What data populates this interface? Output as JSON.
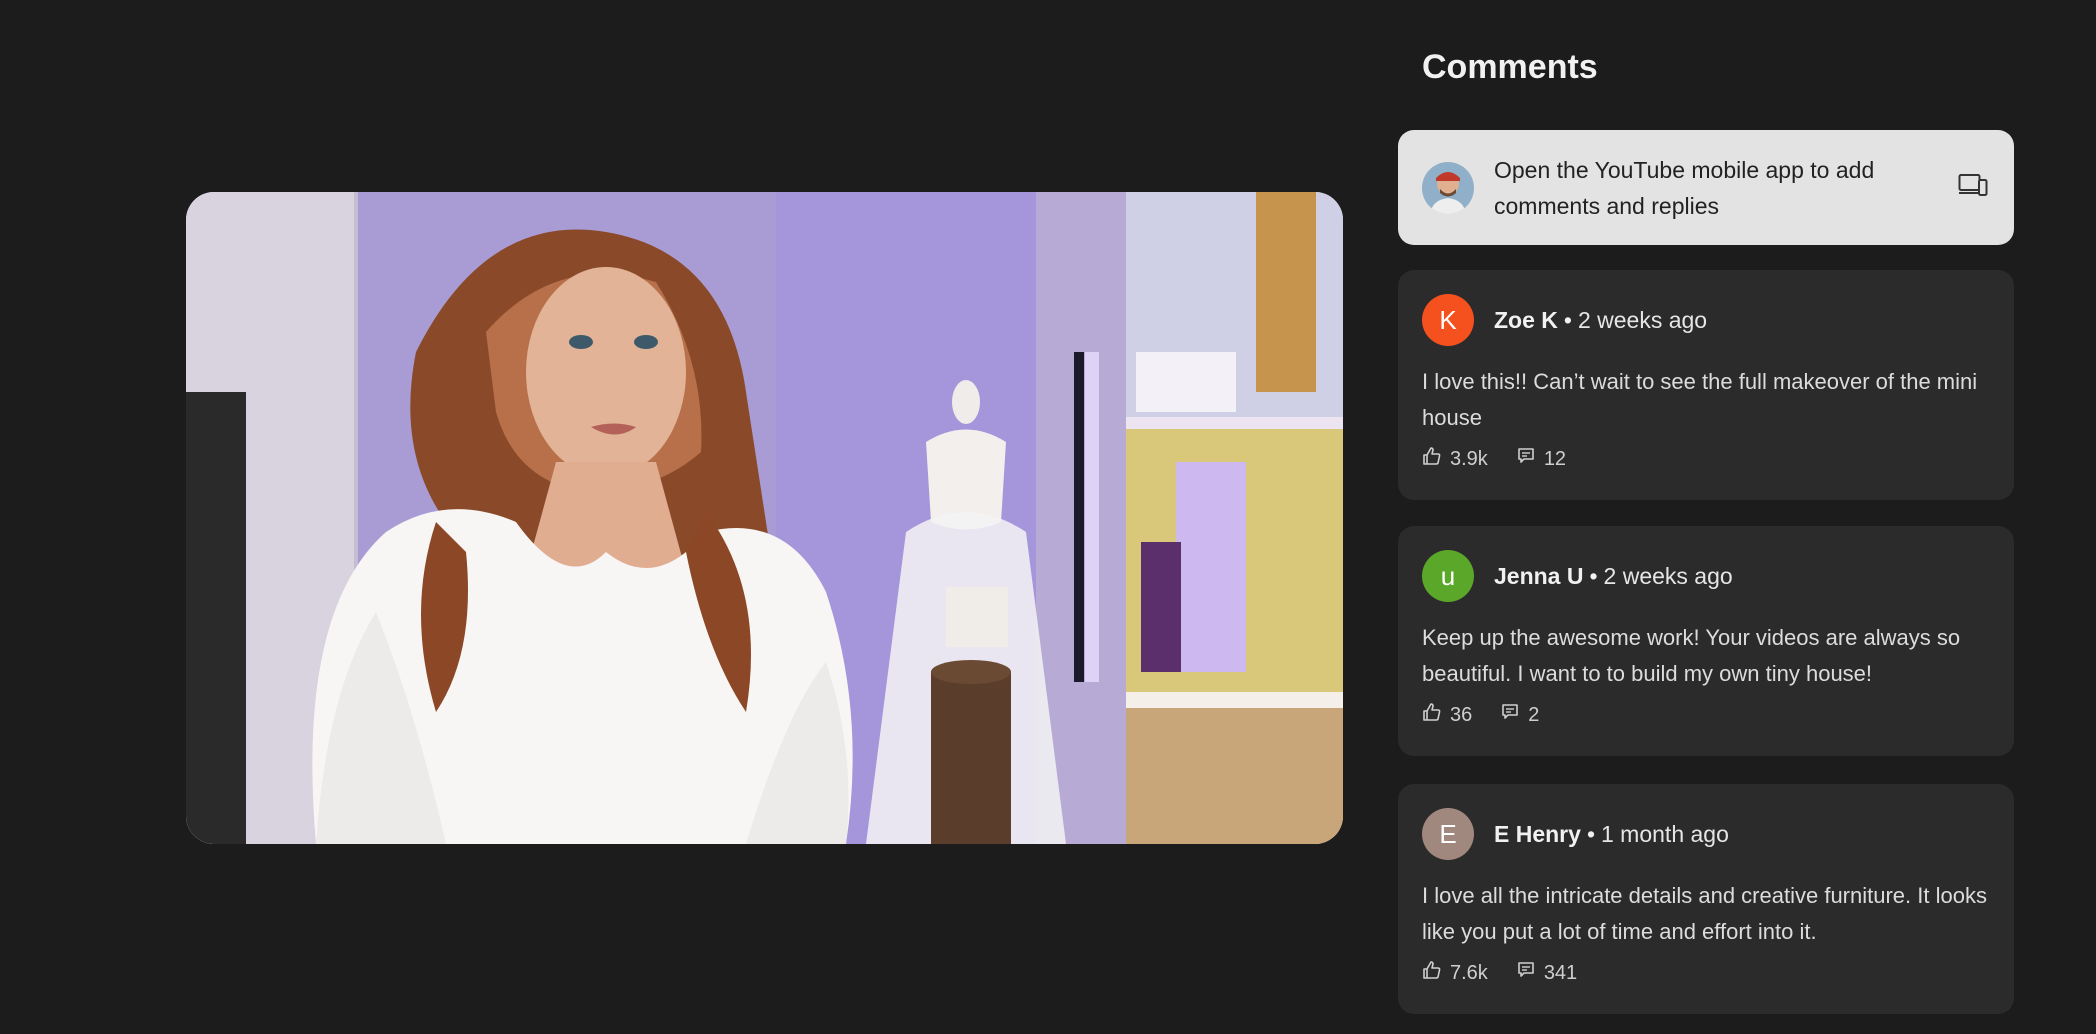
{
  "panel": {
    "title": "Comments",
    "notice": "Open the YouTube mobile app to add comments and replies"
  },
  "comments": [
    {
      "initial": "K",
      "avatar_color": "#f4511e",
      "author": "Zoe K",
      "time": "2 weeks ago",
      "text": "I love this!! Can’t wait to see the full makeover of the mini house",
      "likes": "3.9k",
      "replies": "12"
    },
    {
      "initial": "u",
      "avatar_color": "#5aa72a",
      "author": "Jenna U",
      "time": "2 weeks ago",
      "text": "Keep up the awesome work! Your videos are always so beautiful. I want to to build my own tiny house!",
      "likes": "36",
      "replies": "2"
    },
    {
      "initial": "E",
      "avatar_color": "#a1887f",
      "author": "E Henry",
      "time": "1 month ago",
      "text": "I love all the intricate details and creative furniture. It looks like you put a lot of time and effort into it.",
      "likes": "7.6k",
      "replies": "341"
    }
  ],
  "separator": "•",
  "icons": {
    "notice": "phone-tablet-icon",
    "like": "thumbs-up-icon",
    "reply": "reply-icon"
  }
}
